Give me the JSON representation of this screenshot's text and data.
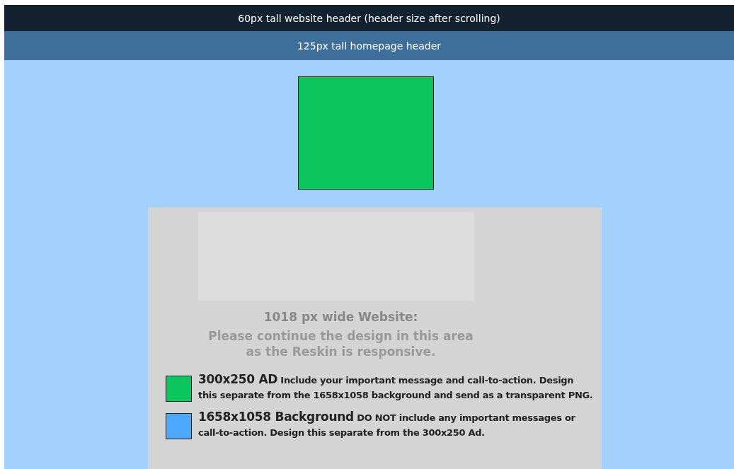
{
  "headers": [
    {
      "kind": "site",
      "label": "60px tall website header (header size after scrolling)"
    },
    {
      "kind": "home",
      "label": "125px tall homepage header"
    }
  ],
  "website": {
    "title": "1018 px wide Website:",
    "note_lines": [
      "Please continue the design in this area",
      "as the Reskin is responsive."
    ]
  },
  "legend": [
    {
      "color": "#0bc55d",
      "title": "300x250 AD",
      "text": " Include your important message and call-to-action. Design this separate from the 1658x1058 background and send as a transparent PNG."
    },
    {
      "color": "#4da9fd",
      "title": "1658x1058 Background",
      "text": " DO NOT include any important messages or call-to-action. Design this separate from the 300x250 Ad."
    }
  ]
}
